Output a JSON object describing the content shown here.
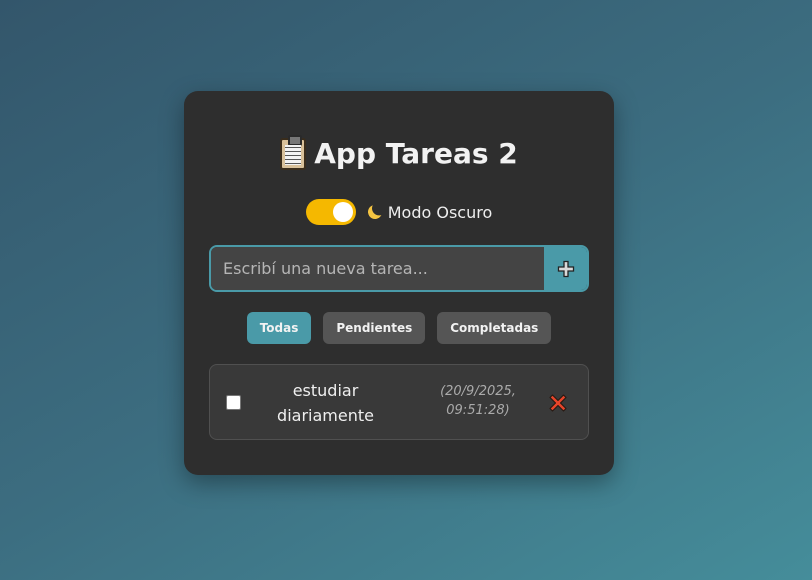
{
  "app": {
    "title": "App Tareas 2",
    "title_icon": "clipboard-icon"
  },
  "theme": {
    "toggle_on": true,
    "mode_label": "Modo Oscuro",
    "mode_icon": "moon-icon",
    "toggle_color": "#f5b800",
    "accent_color": "#4a9aa8"
  },
  "new_task": {
    "placeholder": "Escribí una nueva tarea...",
    "value": "",
    "add_icon": "plus-icon"
  },
  "filters": {
    "all_label": "Todas",
    "pending_label": "Pendientes",
    "completed_label": "Completadas",
    "active": "Todas"
  },
  "tasks": [
    {
      "text": "estudiar diariamente",
      "date": "(20/9/2025, 09:51:28)",
      "completed": false,
      "delete_icon": "close-icon"
    }
  ]
}
